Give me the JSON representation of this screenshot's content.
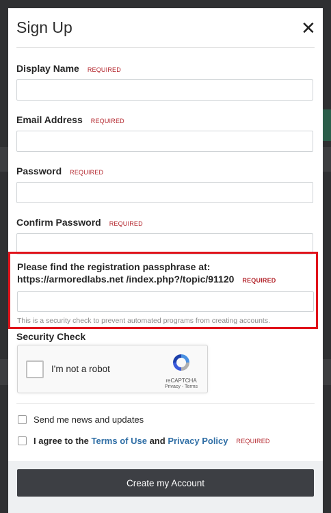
{
  "modal": {
    "title": "Sign Up",
    "close_glyph": "✕"
  },
  "fields": [
    {
      "label": "Display Name",
      "required": "REQUIRED",
      "value": ""
    },
    {
      "label": "Email Address",
      "required": "REQUIRED",
      "value": ""
    },
    {
      "label": "Password",
      "required": "REQUIRED",
      "value": ""
    },
    {
      "label": "Confirm Password",
      "required": "REQUIRED",
      "value": ""
    }
  ],
  "passphrase": {
    "label": "Please find the registration passphrase at: https://armoredlabs.net /index.php?/topic/91120",
    "required": "REQUIRED",
    "value": "",
    "help": "This is a security check to prevent automated programs from creating accounts."
  },
  "security": {
    "title": "Security Check",
    "captcha_text": "I'm not a robot",
    "captcha_brand": "reCAPTCHA",
    "captcha_links": "Privacy - Terms"
  },
  "options": {
    "news_label": "Send me news and updates",
    "agree_prefix": "I agree to the",
    "terms_link": "Terms of Use",
    "and_text": "and",
    "privacy_link": "Privacy Policy",
    "agree_required": "REQUIRED"
  },
  "submit_label": "Create my Account",
  "colors": {
    "required": "#b3242b",
    "highlight_border": "#e0131b",
    "link": "#2f6ea5",
    "button": "#3d3f44"
  }
}
